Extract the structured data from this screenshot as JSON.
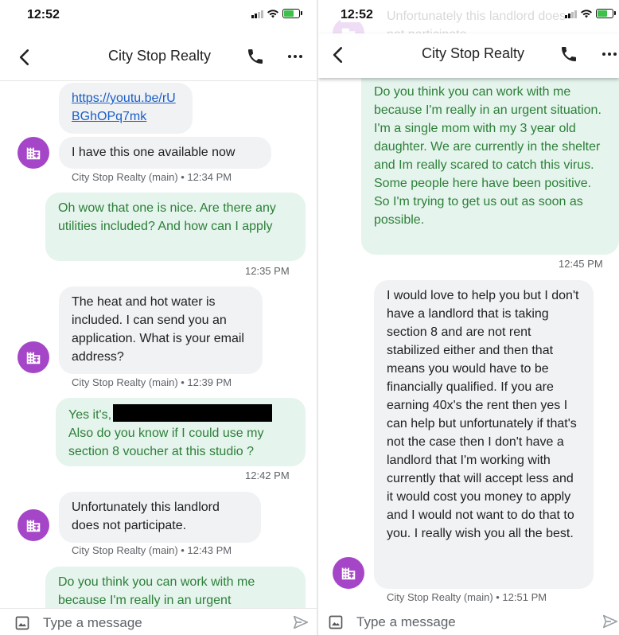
{
  "app": {
    "contact_name": "City Stop Realty",
    "input_placeholder": "Type a message"
  },
  "left": {
    "status_time": "12:52",
    "messages": [
      {
        "dir": "in",
        "link": "https://youtu.be/rUBGhOPq7mk"
      },
      {
        "dir": "in",
        "text": "I have this one available now",
        "meta": "City Stop Realty (main) • 12:34 PM"
      },
      {
        "dir": "out",
        "text": "Oh wow that one is nice. Are there any utilities included? And how can I apply",
        "meta": "12:35 PM"
      },
      {
        "dir": "in",
        "text": "The heat and hot water is included. I can send you an application. What is your email address?",
        "meta": "City Stop Realty (main) • 12:39 PM"
      },
      {
        "dir": "out",
        "text_before": "Yes it's,",
        "text_after": "Also do you know if I could use my section 8 voucher at this studio ?",
        "meta": "12:42 PM"
      },
      {
        "dir": "in",
        "text": "Unfortunately this landlord does not participate.",
        "meta": "City Stop Realty (main) • 12:43 PM"
      },
      {
        "dir": "out",
        "text": "Do you think you can work with me because I'm really in an urgent"
      }
    ]
  },
  "right": {
    "status_time": "12:52",
    "ghost": {
      "text": "Unfortunately this landlord does not participate.",
      "meta": "City Stop Realty (main) • 12:43 PM"
    },
    "messages": [
      {
        "dir": "out",
        "text": "Do you think you can work with me because I'm really in an urgent situation.  I'm a single mom with my 3 year old daughter. We are currently in the shelter and Im really scared to catch this virus. Some people here have been positive. So I'm trying to get us out as soon as possible.",
        "meta": "12:45 PM"
      },
      {
        "dir": "in",
        "text": "I would love to help you but I don't have a landlord that is taking section 8 and are not rent stabilized either and then that means you would have to be financially qualified. If you are earning 40x's the rent then yes I can help but unfortunately if that's not the case then I don't have a landlord that I'm working with currently that will accept less and it would cost you money to apply and I would not want to do that to you. I really wish you all the best.",
        "meta": "City Stop Realty (main) • 12:51 PM"
      }
    ]
  },
  "colors": {
    "incoming_bubble": "#f1f2f4",
    "outgoing_bubble": "#e5f4ec",
    "outgoing_text": "#2d7f39",
    "avatar": "#a546c8",
    "link": "#1a5ec7"
  },
  "icons": [
    "back-arrow-icon",
    "phone-icon",
    "more-vert-icon",
    "business-building-icon",
    "image-icon",
    "send-icon",
    "wifi-icon",
    "battery-charging-icon",
    "signal-icon"
  ]
}
